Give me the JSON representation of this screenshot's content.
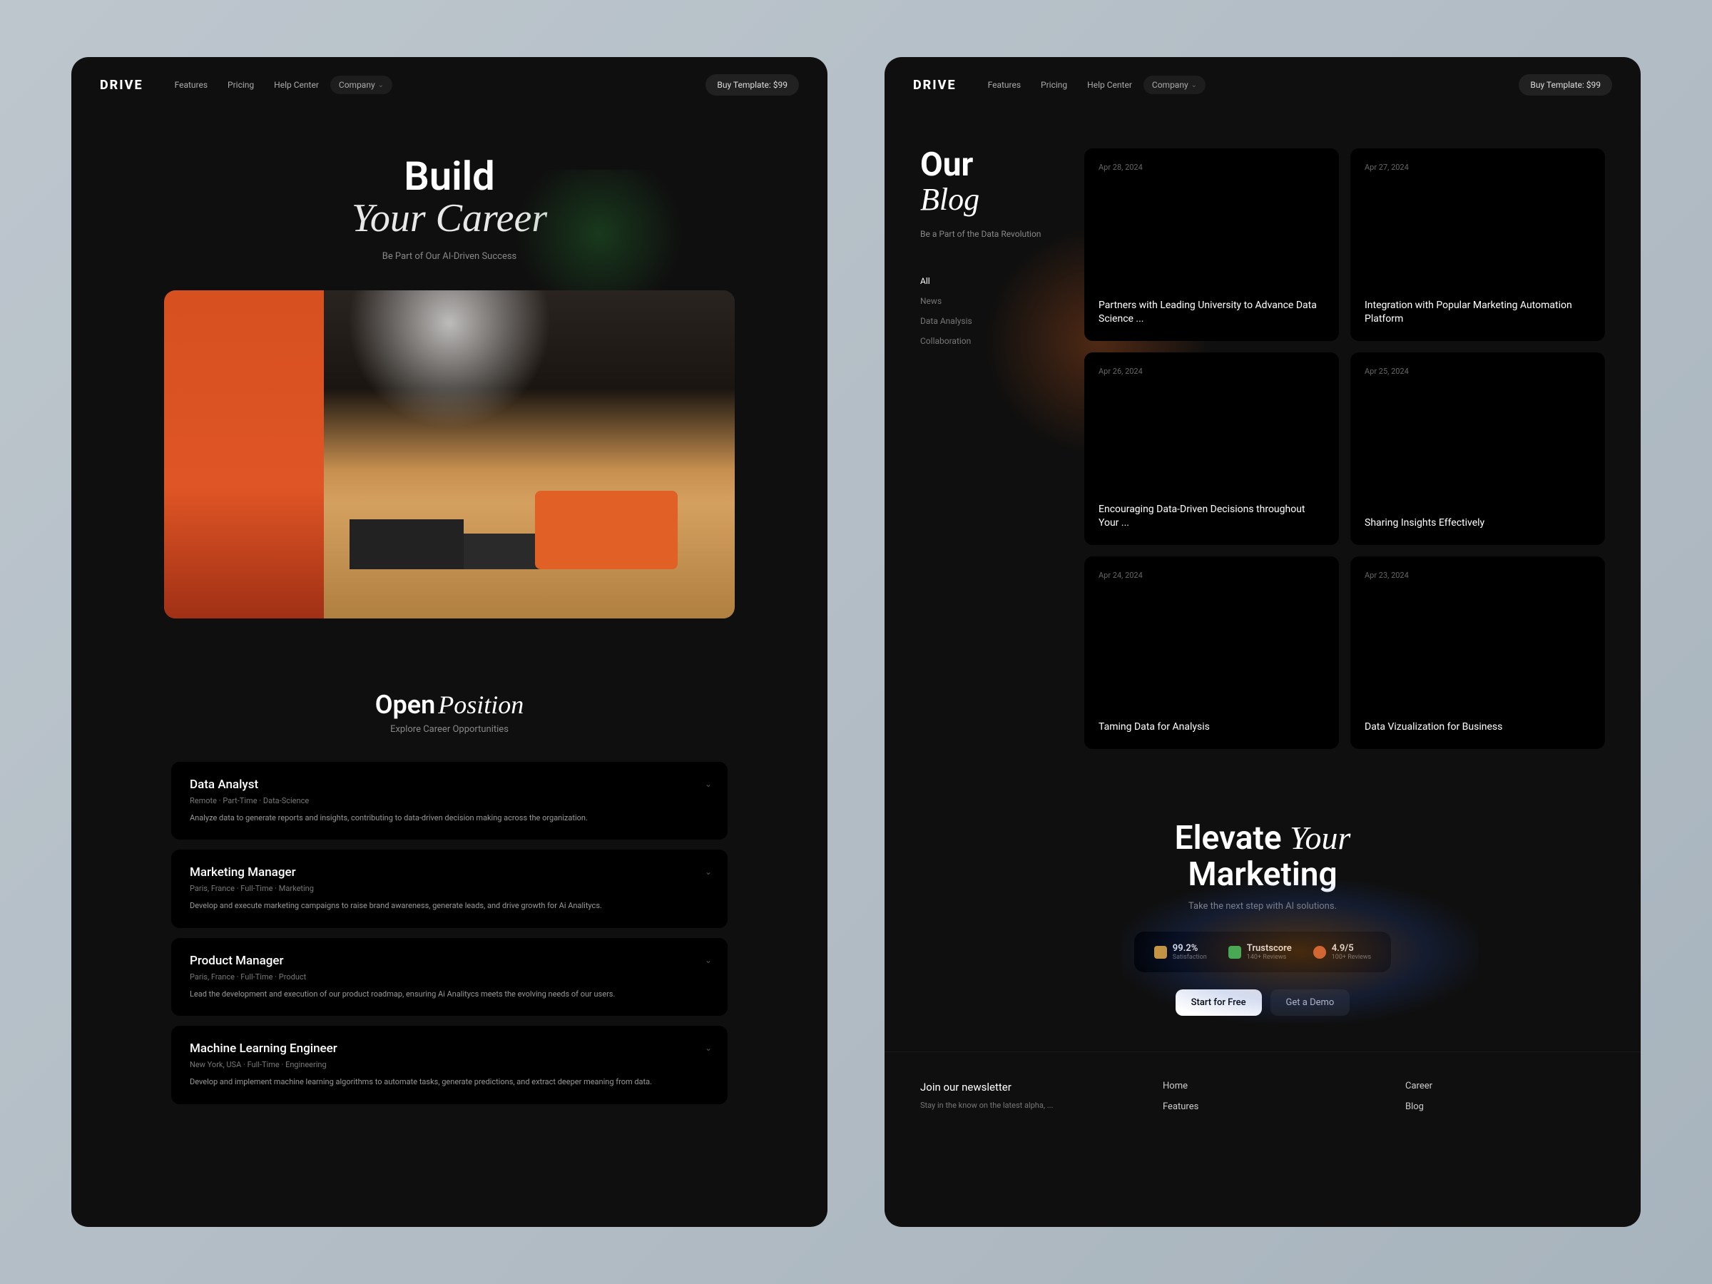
{
  "nav": {
    "brand": "DRIVE",
    "links": [
      "Features",
      "Pricing",
      "Help Center",
      "Company"
    ],
    "cta": "Buy Template: $99"
  },
  "left": {
    "hero": {
      "title1": "Build",
      "title2": "Your Career",
      "subtitle": "Be Part of Our AI-Driven Success"
    },
    "positions": {
      "heading_bold": "Open",
      "heading_it": "Position",
      "sub": "Explore Career Opportunities",
      "jobs": [
        {
          "title": "Data Analyst",
          "meta": [
            "Remote",
            "Part-Time",
            "Data-Science"
          ],
          "desc": "Analyze data to generate reports and insights, contributing to data-driven decision making across the organization."
        },
        {
          "title": "Marketing Manager",
          "meta": [
            "Paris, France",
            "Full-Time",
            "Marketing"
          ],
          "desc": "Develop and execute marketing campaigns to raise brand awareness, generate leads, and drive growth for Ai Analitycs."
        },
        {
          "title": "Product Manager",
          "meta": [
            "Paris, France",
            "Full-Time",
            "Product"
          ],
          "desc": "Lead the development and execution of our product roadmap, ensuring Ai Analitycs meets the evolving needs of our users."
        },
        {
          "title": "Machine Learning Engineer",
          "meta": [
            "New York, USA",
            "Full-Time",
            "Engineering"
          ],
          "desc": "Develop and implement machine learning algorithms to automate tasks, generate predictions, and extract deeper meaning from data."
        }
      ]
    }
  },
  "right": {
    "blog": {
      "h1": "Our",
      "h1_it": "Blog",
      "sub": "Be a Part of the Data Revolution",
      "filters": [
        "All",
        "News",
        "Data Analysis",
        "Collaboration"
      ],
      "cards": [
        {
          "date": "Apr 28, 2024",
          "title": "Partners with Leading University to Advance Data Science ..."
        },
        {
          "date": "Apr 27, 2024",
          "title": "Integration with Popular Marketing Automation Platform"
        },
        {
          "date": "Apr 26, 2024",
          "title": "Encouraging Data-Driven Decisions throughout Your ..."
        },
        {
          "date": "Apr 25, 2024",
          "title": "Sharing Insights Effectively"
        },
        {
          "date": "Apr 24, 2024",
          "title": "Taming Data for Analysis"
        },
        {
          "date": "Apr 23, 2024",
          "title": "Data Vizualization for Business"
        }
      ]
    },
    "cta": {
      "line1a": "Elevate",
      "line1b": "Your",
      "line2": "Marketing",
      "sub": "Take the next step with AI solutions.",
      "badges": [
        {
          "val": "99.2%",
          "lbl": "Satisfaction"
        },
        {
          "val": "Trustscore",
          "lbl": "140+ Reviews"
        },
        {
          "val": "4.9/5",
          "lbl": "100+ Reviews"
        }
      ],
      "primary": "Start for Free",
      "ghost": "Get a Demo"
    },
    "footer": {
      "newsletter_h": "Join our newsletter",
      "newsletter_sub": "Stay in the know on the latest alpha, ...",
      "cols": [
        [
          "Home",
          "Features"
        ],
        [
          "Career",
          "Blog"
        ]
      ]
    }
  }
}
